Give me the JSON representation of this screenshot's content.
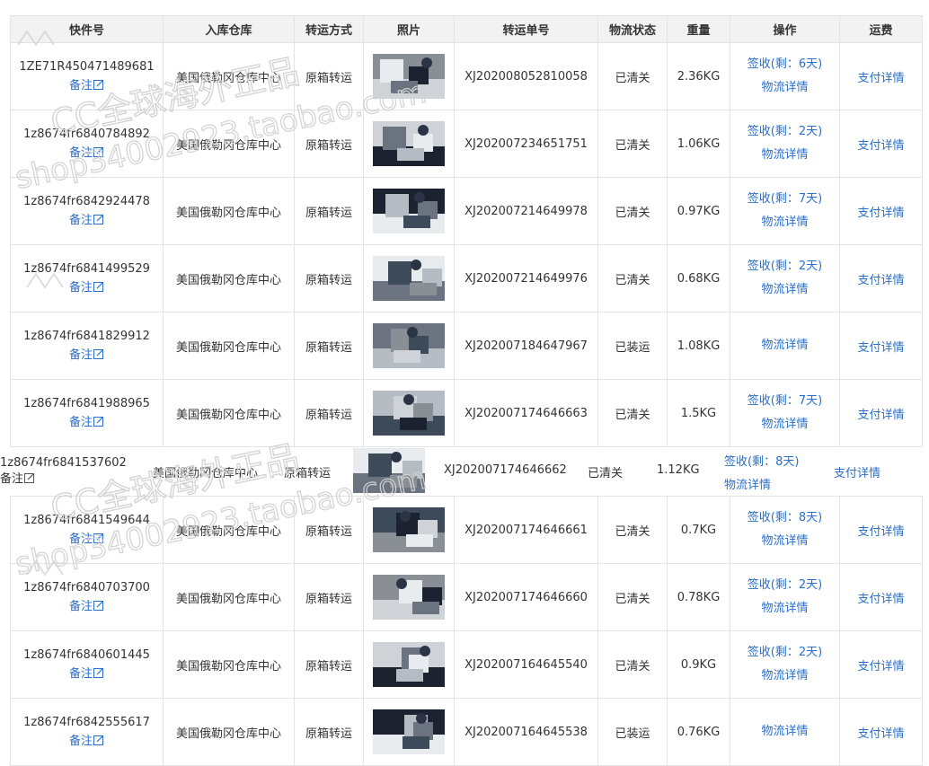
{
  "columns": [
    "快件号",
    "入库仓库",
    "转运方式",
    "照片",
    "转运单号",
    "物流状态",
    "重量",
    "操作",
    "运费"
  ],
  "labels": {
    "note": "备注",
    "logistics_detail": "物流详情",
    "pay_detail": "支付详情"
  },
  "rows_top": [
    {
      "tracking": "1ZE71R450471489681",
      "warehouse": "美国俄勒冈仓库中心",
      "method": "原箱转运",
      "transfer_no": "XJ202008052810058",
      "status": "已清关",
      "weight": "2.36KG",
      "sign": "签收(剩：6天)"
    },
    {
      "tracking": "1z8674fr6840784892",
      "warehouse": "美国俄勒冈仓库中心",
      "method": "原箱转运",
      "transfer_no": "XJ202007234651751",
      "status": "已清关",
      "weight": "1.06KG",
      "sign": "签收(剩：2天)"
    },
    {
      "tracking": "1z8674fr6842924478",
      "warehouse": "美国俄勒冈仓库中心",
      "method": "原箱转运",
      "transfer_no": "XJ202007214649978",
      "status": "已清关",
      "weight": "0.97KG",
      "sign": "签收(剩：7天)"
    },
    {
      "tracking": "1z8674fr6841499529",
      "warehouse": "美国俄勒冈仓库中心",
      "method": "原箱转运",
      "transfer_no": "XJ202007214649976",
      "status": "已清关",
      "weight": "0.68KG",
      "sign": "签收(剩：2天)"
    },
    {
      "tracking": "1z8674fr6841829912",
      "warehouse": "美国俄勒冈仓库中心",
      "method": "原箱转运",
      "transfer_no": "XJ202007184647967",
      "status": "已装运",
      "weight": "1.08KG",
      "sign": ""
    },
    {
      "tracking": "1z8674fr6841988965",
      "warehouse": "美国俄勒冈仓库中心",
      "method": "原箱转运",
      "transfer_no": "XJ202007174646663",
      "status": "已清关",
      "weight": "1.5KG",
      "sign": "签收(剩：7天)"
    }
  ],
  "loose_row": {
    "tracking": "1z8674fr6841537602",
    "warehouse": "美国俄勒冈仓库中心",
    "method": "原箱转运",
    "transfer_no": "XJ202007174646662",
    "status": "已清关",
    "weight": "1.12KG",
    "sign": "签收(剩：8天)"
  },
  "rows_bottom": [
    {
      "tracking": "1z8674fr6841549644",
      "warehouse": "美国俄勒冈仓库中心",
      "method": "原箱转运",
      "transfer_no": "XJ202007174646661",
      "status": "已清关",
      "weight": "0.7KG",
      "sign": "签收(剩：8天)"
    },
    {
      "tracking": "1z8674fr6840703700",
      "warehouse": "美国俄勒冈仓库中心",
      "method": "原箱转运",
      "transfer_no": "XJ202007174646660",
      "status": "已清关",
      "weight": "0.78KG",
      "sign": "签收(剩：2天)"
    },
    {
      "tracking": "1z8674fr6840601445",
      "warehouse": "美国俄勒冈仓库中心",
      "method": "原箱转运",
      "transfer_no": "XJ202007164645540",
      "status": "已清关",
      "weight": "0.9KG",
      "sign": "签收(剩：2天)"
    },
    {
      "tracking": "1z8674fr6842555617",
      "warehouse": "美国俄勒冈仓库中心",
      "method": "原箱转运",
      "transfer_no": "XJ202007164645538",
      "status": "已装运",
      "weight": "0.76KG",
      "sign": ""
    }
  ],
  "watermark": {
    "line1": "CC全球海外正品",
    "line2": "shop34002923.taobao.com"
  },
  "colors": {
    "link": "#2a6fc9",
    "header_bg": "#f2f2f2",
    "border": "#e3e3e3",
    "text": "#333333"
  }
}
